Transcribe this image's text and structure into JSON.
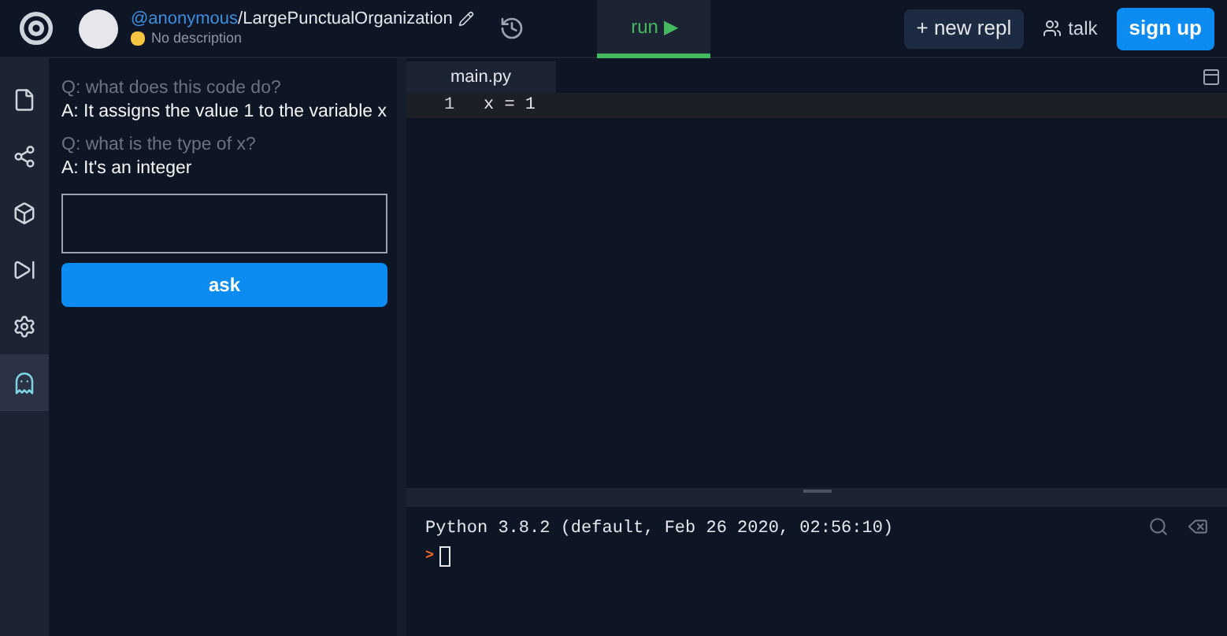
{
  "header": {
    "owner": "@anonymous",
    "separator": "/",
    "repl_name": "LargePunctualOrganization",
    "description": "No description",
    "run_label": "run ▶",
    "new_repl_label": "+ new repl",
    "talk_label": "talk",
    "signup_label": "sign up"
  },
  "rail": [
    {
      "kind": "files",
      "selected": false
    },
    {
      "kind": "share",
      "selected": false
    },
    {
      "kind": "packages",
      "selected": false
    },
    {
      "kind": "debugger",
      "selected": false
    },
    {
      "kind": "settings",
      "selected": false
    },
    {
      "kind": "assistant",
      "selected": true
    }
  ],
  "qa": [
    {
      "question": "Q: what does this code do?",
      "answer": "A: It assigns the value 1 to the variable x"
    },
    {
      "question": "Q: what is the type of x?",
      "answer": "A: It's an integer"
    }
  ],
  "ask_label": "ask",
  "editor": {
    "tab": "main.py",
    "lines": [
      {
        "number": "1",
        "code": "x = 1"
      }
    ]
  },
  "console": {
    "banner": "Python 3.8.2 (default, Feb 26 2020, 02:56:10)",
    "prompt": ">"
  }
}
